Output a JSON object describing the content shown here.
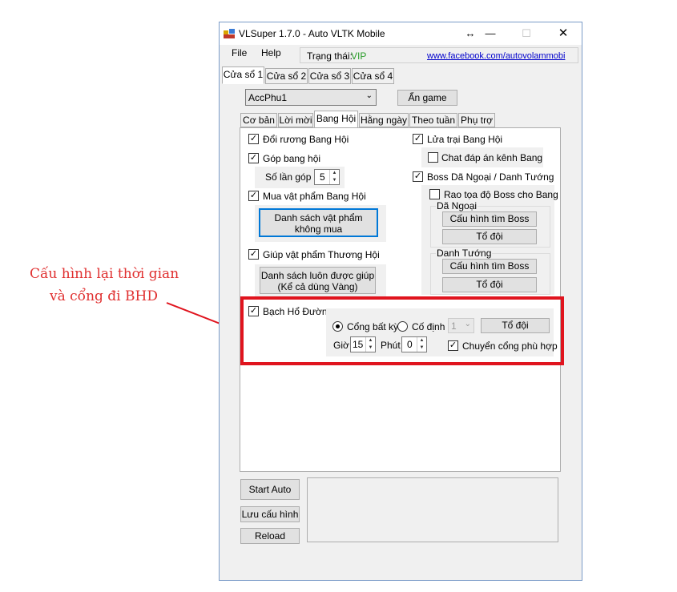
{
  "window": {
    "title": "VLSuper 1.7.0 - Auto VLTK Mobile",
    "controls": [
      "↔",
      "—",
      "☐",
      "✕"
    ]
  },
  "menu": {
    "file": "File",
    "help": "Help"
  },
  "status": {
    "label": "Trạng thái:",
    "value": "VIP",
    "link": "www.facebook.com/autovolammobi"
  },
  "window_tabs": [
    "Cửa sổ 1",
    "Cửa sổ 2",
    "Cửa sổ 3",
    "Cửa sổ 4"
  ],
  "account": {
    "selected": "AccPhu1",
    "hide_game_button": "Ẩn game"
  },
  "feature_tabs": [
    "Cơ bản",
    "Lời mời",
    "Bang Hội",
    "Hằng ngày",
    "Theo tuần",
    "Phụ trợ"
  ],
  "bang_hoi": {
    "doi_ruong": "Đổi rương Bang Hội",
    "gop_bang_hoi": "Góp bang hội",
    "so_lan_gop_label": "Số lần góp",
    "so_lan_gop_value": "5",
    "mua_vat_pham": "Mua vật phẩm Bang Hội",
    "danh_sach_khong_mua_line1": "Danh sách vật phẩm",
    "danh_sach_khong_mua_line2": "không mua",
    "giup_vat_pham": "Giúp vật phẩm Thương Hội",
    "danh_sach_giup_line1": "Danh sách luôn được giúp",
    "danh_sach_giup_line2": "(Kể cả dùng Vàng)",
    "lua_trai": "Lửa trại Bang Hội",
    "chat_dap_an": "Chat đáp án kênh Bang",
    "boss": "Boss Dã Ngoại / Danh Tướng",
    "rao_toa_do": "Rao tọa độ Boss cho Bang",
    "da_ngoai_group": "Dã Ngoại",
    "danh_tuong_group": "Danh Tướng",
    "cau_hinh_tim_boss": "Cấu hình tìm Boss",
    "to_doi": "Tổ đội",
    "bach_ho_duong": "Bạch Hổ Đường",
    "cong_bat_ky": "Cổng bất kỳ",
    "co_dinh": "Cố định",
    "cong_select": "1",
    "gio_label": "Giờ",
    "gio_value": "15",
    "phut_label": "Phút",
    "phut_value": "0",
    "chuyen_cong": "Chuyển cổng phù hợp"
  },
  "bottom_buttons": {
    "start": "Start Auto",
    "save": "Lưu cấu hình",
    "reload": "Reload"
  },
  "annotation": {
    "line1": "Cấu hình lại thời gian",
    "line2": "và cổng đi BHD"
  },
  "colors": {
    "highlight_box": "#e0141e",
    "vip": "#2a9d2a",
    "link": "#0000cc",
    "annotation_text": "#e03030"
  }
}
